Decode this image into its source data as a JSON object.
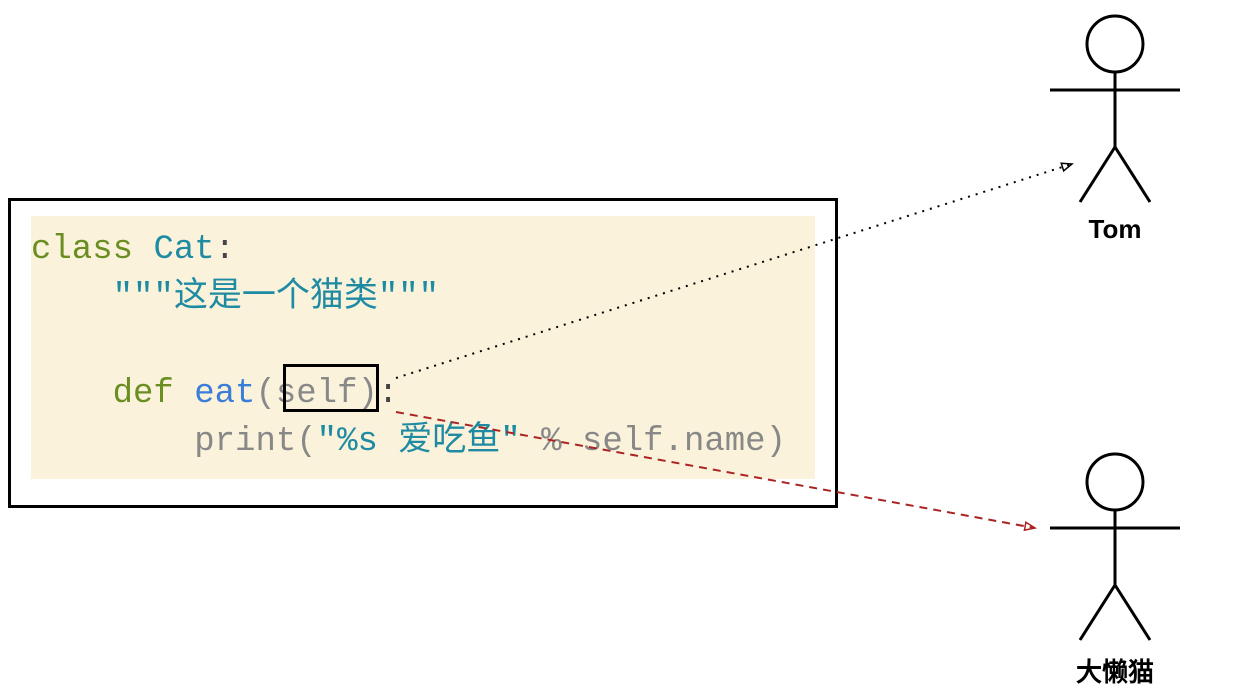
{
  "code": {
    "keyword_class": "class",
    "class_name": "Cat",
    "colon1": ":",
    "docstring": "\"\"\"这是一个猫类\"\"\"",
    "keyword_def": "def",
    "function_name": "eat",
    "paren_open": "(",
    "param_self": "self",
    "paren_close": ")",
    "colon2": ":",
    "print_fn": "print",
    "paren_open2": "(",
    "string_literal": "\"%s 爱吃鱼\"",
    "percent_op": " % ",
    "self_attr": "self.name",
    "paren_close2": ")"
  },
  "figures": {
    "tom_label": "Tom",
    "lazy_cat_label": "大懒猫"
  }
}
